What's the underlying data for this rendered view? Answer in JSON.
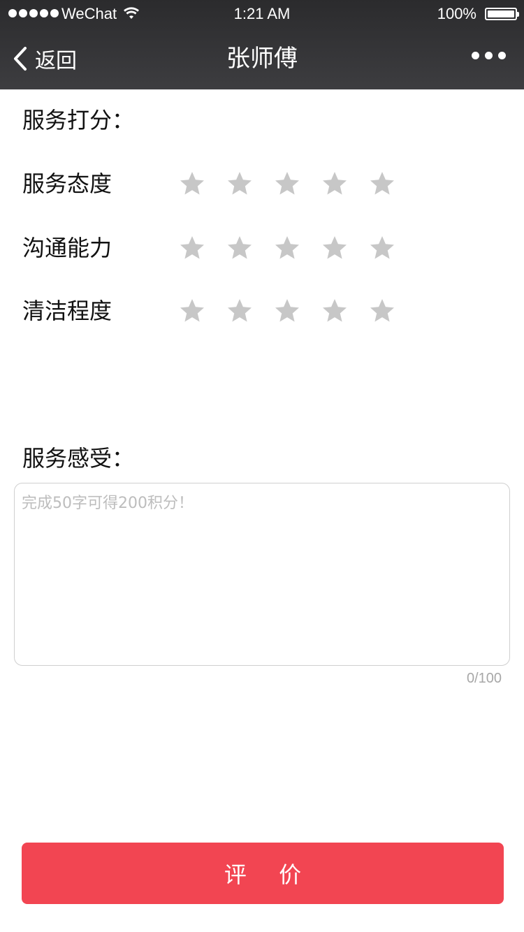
{
  "status_bar": {
    "carrier": "WeChat",
    "time": "1:21 AM",
    "battery": "100%",
    "signal_icon": "signal-dots-icon",
    "wifi_icon": "wifi-icon",
    "battery_icon": "battery-icon"
  },
  "nav": {
    "back_label": "返回",
    "title": "张师傅",
    "more_icon": "more-dots-icon"
  },
  "rating": {
    "heading": "服务打分：",
    "rows": [
      {
        "label": "服务态度",
        "stars_total": 5,
        "stars_selected": 0
      },
      {
        "label": "沟通能力",
        "stars_total": 5,
        "stars_selected": 0
      },
      {
        "label": "清洁程度",
        "stars_total": 5,
        "stars_selected": 0
      }
    ]
  },
  "feedback": {
    "heading": "服务感受：",
    "placeholder": "完成50字可得200积分！",
    "value": "",
    "counter": "0/100"
  },
  "submit_label": "评 价",
  "colors": {
    "header_bg": "#2b2b2d",
    "star_inactive": "#c7c7c7",
    "accent": "#f24552",
    "border": "#cfcfcf"
  }
}
